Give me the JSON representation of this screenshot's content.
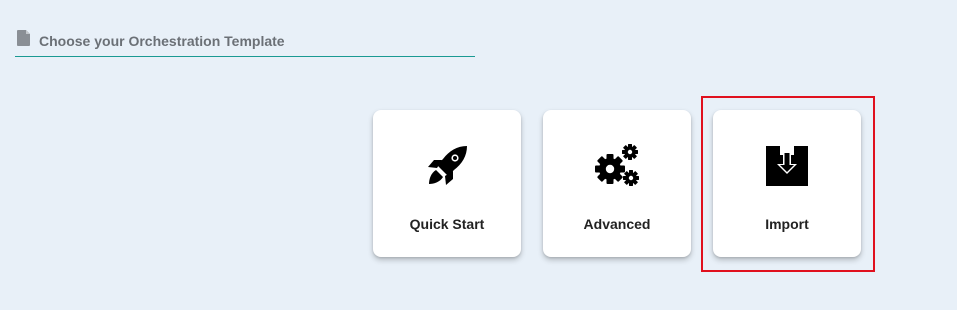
{
  "header": {
    "title": "Choose your Orchestration Template",
    "icon": "document-icon"
  },
  "templates": [
    {
      "label": "Quick Start",
      "icon": "rocket-icon"
    },
    {
      "label": "Advanced",
      "icon": "gears-icon"
    },
    {
      "label": "Import",
      "icon": "import-box-icon",
      "highlighted": true
    }
  ],
  "colors": {
    "background": "#e8f0f8",
    "header_underline": "#1a9a93",
    "header_text": "#6b7076",
    "highlight": "#e0101e"
  }
}
